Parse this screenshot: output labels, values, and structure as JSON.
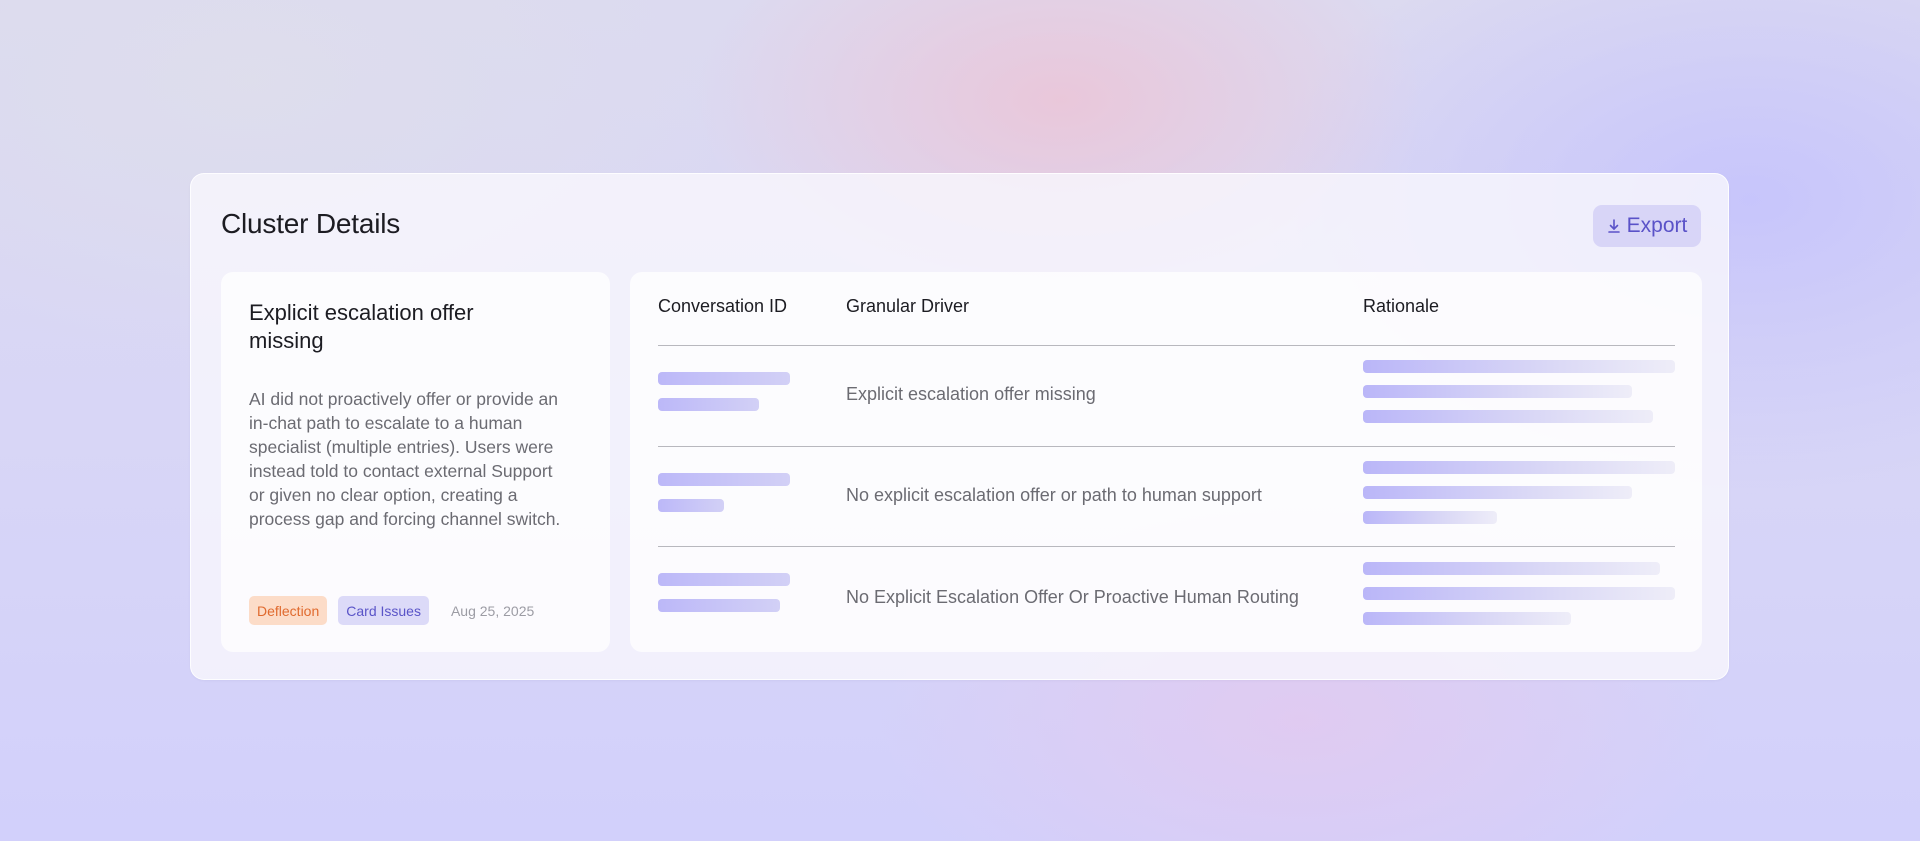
{
  "header": {
    "title": "Cluster Details",
    "export_label": "Export",
    "export_icon": "download-icon"
  },
  "cluster": {
    "title": "Explicit escalation offer missing",
    "description": "AI did not proactively offer or provide an in-chat path to escalate to a human specialist (multiple entries). Users were instead told to contact external Support or given no clear option, creating a process gap and forcing channel switch.",
    "tags": [
      "Deflection",
      "Card Issues"
    ],
    "date": "Aug 25, 2025"
  },
  "table": {
    "columns": [
      "Conversation ID",
      "Granular Driver",
      "Rationale"
    ],
    "rows": [
      {
        "driver": "Explicit escalation offer missing"
      },
      {
        "driver": "No explicit escalation offer or path to human support"
      },
      {
        "driver": "No Explicit Escalation Offer Or Proactive Human Routing"
      }
    ]
  },
  "colors": {
    "accent": "#5a52c8",
    "tag_deflection_bg": "#fcdcc8",
    "tag_deflection_fg": "#e06a2e",
    "tag_card_bg": "#dcdaf8",
    "tag_card_fg": "#5a54c8"
  }
}
